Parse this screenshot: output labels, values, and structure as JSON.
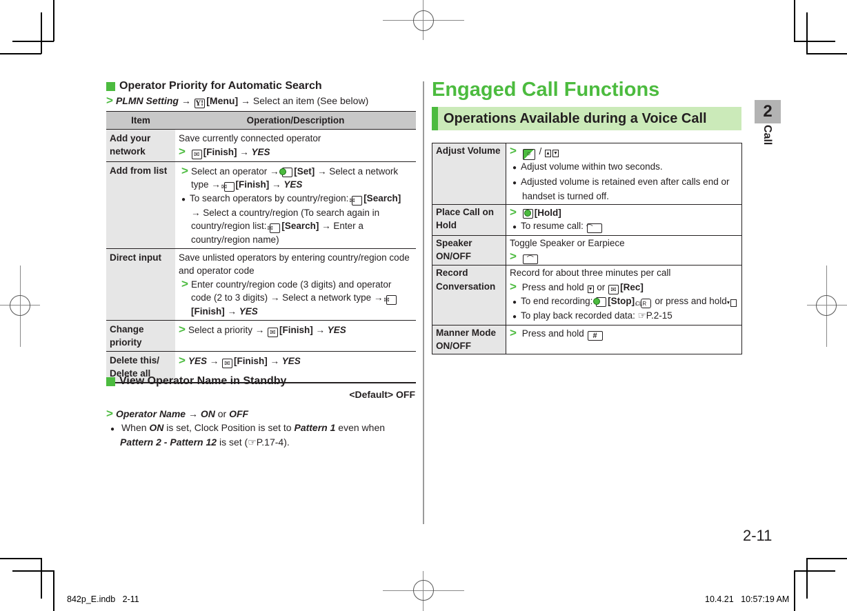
{
  "left": {
    "section1": {
      "title": "Operator Priority for Automatic Search",
      "path": {
        "start": "PLMN Setting",
        "key_icon": "yahoo-key-icon",
        "key_label": "Y!",
        "menu": "[Menu]",
        "rest": "Select an item (See below)"
      },
      "table": {
        "headers": [
          "Item",
          "Operation/Description"
        ],
        "rows": [
          {
            "item": "Add your network",
            "lines": {
              "desc": "Save currently connected operator",
              "finish": "[Finish]",
              "yes": "YES"
            }
          },
          {
            "item": "Add from list",
            "lines": {
              "step1_a": "Select an operator",
              "set": "[Set]",
              "step1_b": "Select a network type",
              "finish": "[Finish]",
              "yes": "YES",
              "bullet_a": "To search operators by country/region:",
              "search": "[Search]",
              "bullet_b": "Select a country/region (To search again in country/region list:",
              "search2": "[Search]",
              "bullet_c": "Enter a country/region name)"
            }
          },
          {
            "item": "Direct input",
            "lines": {
              "desc": "Save unlisted operators by entering country/region code and operator code",
              "step": "Enter country/region code (3 digits) and operator code (2 to 3 digits)",
              "step_b": "Select a network type",
              "finish": "[Finish]",
              "yes": "YES"
            }
          },
          {
            "item": "Change priority",
            "lines": {
              "step": "Select a priority",
              "finish": "[Finish]",
              "yes": "YES"
            }
          },
          {
            "item": "Delete this/ Delete all",
            "lines": {
              "yes1": "YES",
              "finish": "[Finish]",
              "yes2": "YES"
            }
          }
        ]
      }
    },
    "section2": {
      "title": "View Operator Name in Standby",
      "default": "<Default> OFF",
      "path": {
        "start": "Operator Name",
        "on": "ON",
        "or": "or",
        "off": "OFF"
      },
      "note": {
        "a": "When",
        "on": "ON",
        "b": "is set, Clock Position is set to",
        "p1": "Pattern 1",
        "c": "even when",
        "p2": "Pattern 2 - Pattern 12",
        "d": "is set (",
        "ref": "P.17-4",
        "e": ")."
      }
    }
  },
  "right": {
    "title": "Engaged Call Functions",
    "subtitle": "Operations Available during a Voice Call",
    "rows": [
      {
        "item": "Adjust Volume",
        "slash": "/",
        "bullets": [
          "Adjust volume within two seconds.",
          "Adjusted volume is retained even after calls end or handset is turned off."
        ]
      },
      {
        "item": "Place Call on Hold",
        "hold": "[Hold]",
        "bullet": "To resume call:"
      },
      {
        "item": "Speaker ON/OFF",
        "desc": "Toggle Speaker or Earpiece"
      },
      {
        "item": "Record Conversation",
        "desc": "Record for about three minutes per call",
        "step_a": "Press and hold",
        "step_or": "or",
        "rec": "[Rec]",
        "bullet1_a": "To end recording:",
        "stop": "[Stop]",
        "clr": "CLR",
        "bullet1_b": "or press and hold",
        "bullet2": "To play back recorded data:",
        "ref": "P.2-15"
      },
      {
        "item": "Manner Mode ON/OFF",
        "step": "Press and hold",
        "hash": "#"
      }
    ]
  },
  "side_tab": {
    "number": "2",
    "label": "Call"
  },
  "page_number": "2-11",
  "slug": {
    "file": "842p_E.indb   2-11",
    "datetime": "10.4.21   10:57:19 AM"
  },
  "colors": {
    "accent_green": "#4cbb3f",
    "band_green": "#cbeab9",
    "header_gray": "#c8c8c8",
    "item_gray": "#e6e6e6"
  }
}
